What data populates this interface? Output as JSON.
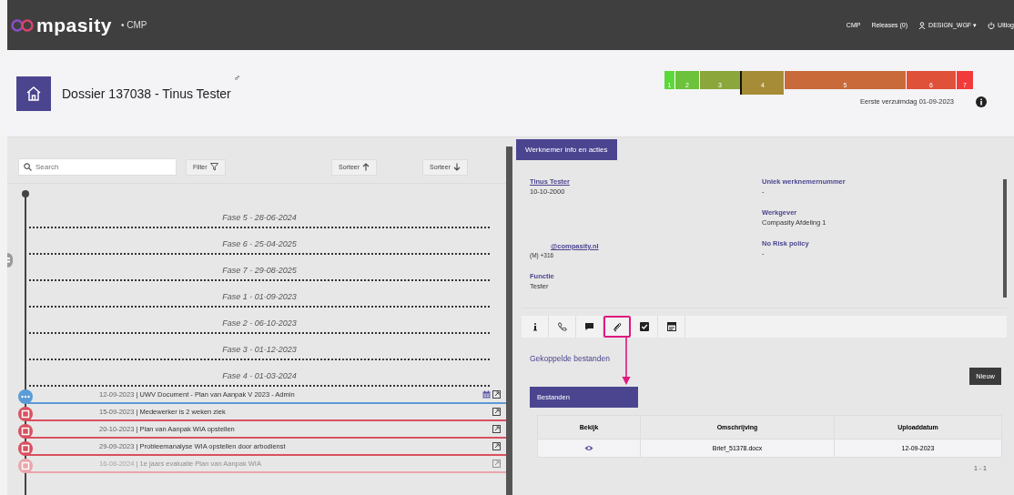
{
  "topbar": {
    "logo_text": "mpasity",
    "app": "• CMP",
    "links": [
      {
        "kind": "text",
        "label": "CMP"
      },
      {
        "kind": "text",
        "label": "Releases (0)"
      },
      {
        "kind": "user",
        "label": "DESIGN_WGF ▾"
      },
      {
        "kind": "logout",
        "label": "Uitlog"
      }
    ]
  },
  "header": {
    "title": "Dossier 137038 - Tinus Tester",
    "gender": "♂",
    "phases": [
      {
        "label": "1",
        "color": "#5cd93a",
        "current": false
      },
      {
        "label": "2",
        "color": "#6cc23b",
        "current": false
      },
      {
        "label": "3",
        "color": "#8ba63b",
        "current": false
      },
      {
        "label": "4",
        "color": "#a68c37",
        "current": true
      },
      {
        "label": "5",
        "color": "#c86a3a",
        "current": false
      },
      {
        "label": "6",
        "color": "#e0513a",
        "current": false
      },
      {
        "label": "7",
        "color": "#f23a3a",
        "current": false
      }
    ],
    "first_absence": "Eerste verzuimdag 01-09-2023"
  },
  "left": {
    "search": {
      "placeholder": "Search"
    },
    "filter": "Filter",
    "sort_up": "Sorteer",
    "sort_down": "Sorteer",
    "timeline": [
      {
        "kind": "phase",
        "label": "Fase 5 - 28-06-2024"
      },
      {
        "kind": "phase",
        "label": "Fase 6 - 25-04-2025"
      },
      {
        "kind": "phase",
        "label": "Fase 7 - 29-08-2025"
      },
      {
        "kind": "phase",
        "label": "Fase 1 - 01-09-2023"
      },
      {
        "kind": "phase",
        "label": "Fase 2 - 06-10-2023"
      },
      {
        "kind": "phase",
        "label": "Fase 3 - 01-12-2023"
      },
      {
        "kind": "phase",
        "label": "Fase 4 - 01-03-2024"
      },
      {
        "kind": "document",
        "date": "12-09-2023",
        "separator": "|",
        "text": "UWV Document - Plan van Aanpak V 2023 - Admin",
        "color": "#5b9bd5",
        "faded": false,
        "calendar": true
      },
      {
        "kind": "task",
        "date": "15-09-2023",
        "separator": "|",
        "text": "Medewerker is 2 weken ziek",
        "color": "#d9505f",
        "faded": false,
        "calendar": false
      },
      {
        "kind": "task",
        "date": "20-10-2023",
        "separator": "|",
        "text": "Plan van Aanpak WIA opstellen",
        "color": "#d9505f",
        "faded": false,
        "calendar": false
      },
      {
        "kind": "task",
        "date": "29-09-2023",
        "separator": "|",
        "text": "Probleemanalyse WIA opstellen door arbodienst",
        "color": "#d9505f",
        "faded": false,
        "calendar": false
      },
      {
        "kind": "task",
        "date": "16-08-2024",
        "separator": "|",
        "text": "1e jaars evaluatie Plan van Aanpak WIA",
        "color": "#eaa5ad",
        "faded": true,
        "calendar": false
      }
    ]
  },
  "right": {
    "tab": "Werknemer info en acties",
    "info_left": [
      {
        "kind": "link",
        "label": "Tinus Tester",
        "value": "10-10-2000"
      },
      {
        "kind": "email",
        "label": "@compasity.nl",
        "value": "(M) +316"
      },
      {
        "kind": "field",
        "label": "Functie",
        "value": "Tester"
      }
    ],
    "info_right": [
      {
        "label": "Uniek werknemernummer",
        "value": "-"
      },
      {
        "label": "Werkgever",
        "value": "Compasity Afdeling 1"
      },
      {
        "label": "No Risk policy",
        "value": "-"
      }
    ],
    "actions": [
      {
        "kind": "info",
        "selected": false
      },
      {
        "kind": "phone",
        "selected": false
      },
      {
        "kind": "chat",
        "selected": false
      },
      {
        "kind": "attach",
        "selected": true
      },
      {
        "kind": "check",
        "selected": false
      },
      {
        "kind": "form",
        "selected": false
      }
    ],
    "section_title": "Gekoppelde bestanden",
    "new_button": "Nieuw",
    "panel_title": "Bestanden",
    "table": {
      "columns": [
        "Bekijk",
        "Omschrijving",
        "Uploaddatum"
      ],
      "rows": [
        {
          "description": "Brief_51378.docx",
          "date": "12-09-2023"
        }
      ]
    },
    "pagination": "1 - 1"
  }
}
